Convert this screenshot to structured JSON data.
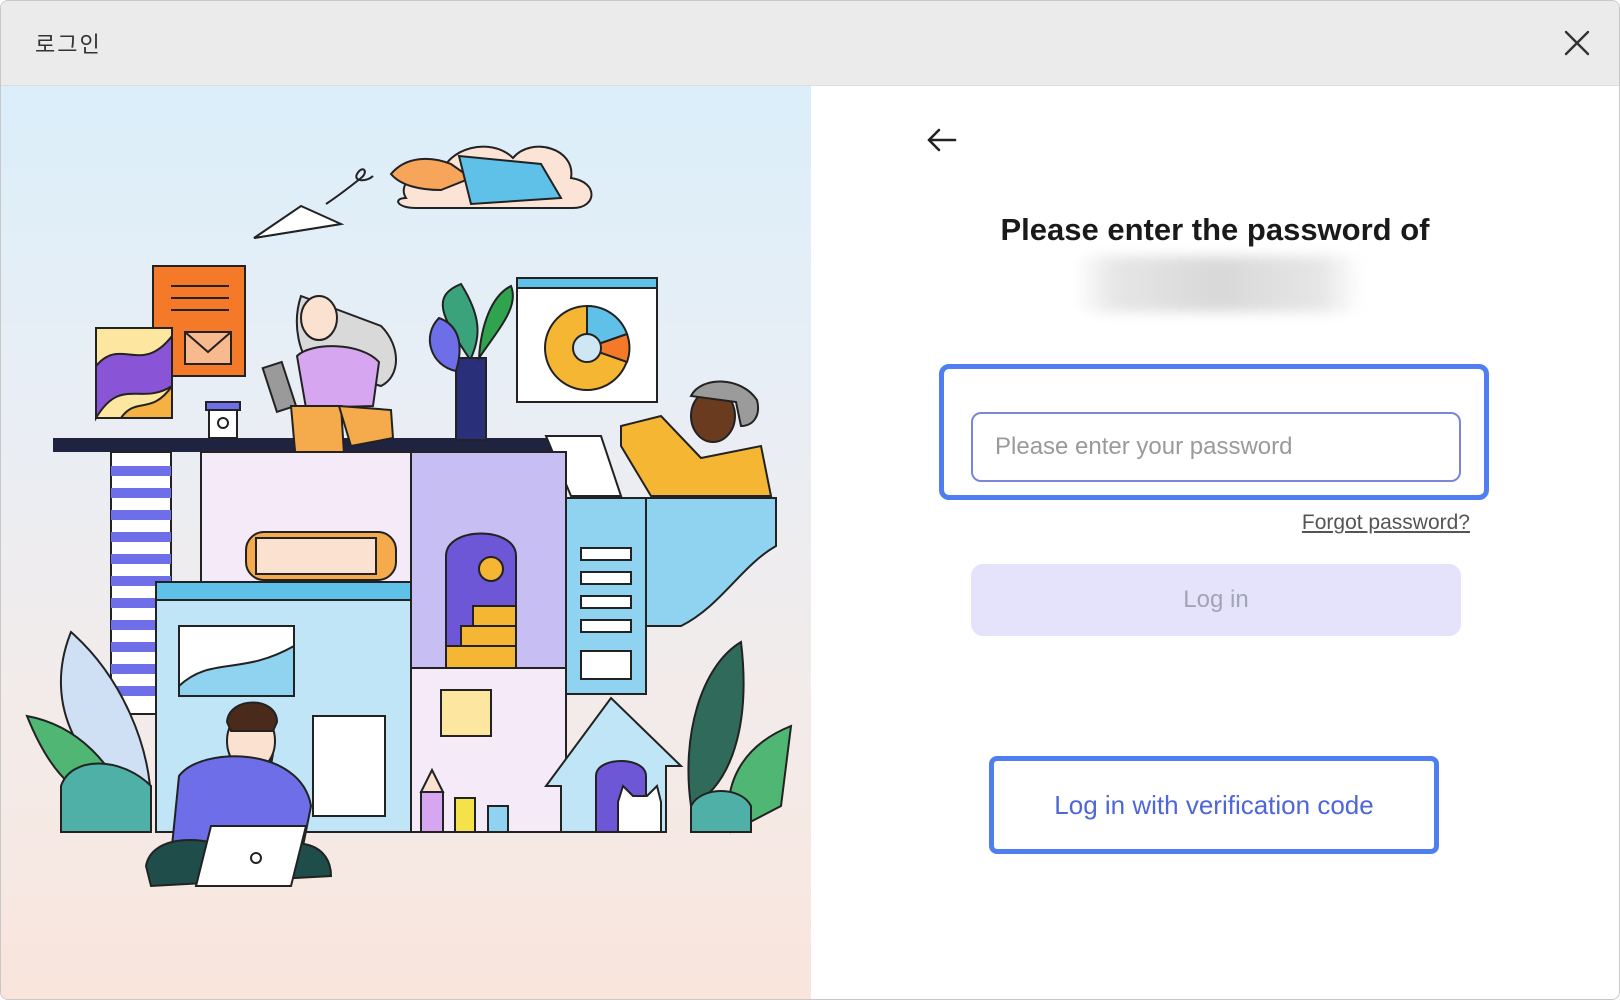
{
  "window": {
    "title": "로그인",
    "close_icon": "close-icon"
  },
  "login": {
    "back_icon": "arrow-left-icon",
    "heading": "Please enter the password of",
    "password_placeholder": "Please enter your password",
    "password_value": "",
    "forgot_password": "Forgot password?",
    "login_button": "Log in",
    "verification_button": "Log in with verification code"
  },
  "colors": {
    "accent": "#4f7ef0",
    "login_button_bg": "#e4e3fb",
    "login_button_text": "#a3a3b8",
    "verification_text": "#4f66d8"
  }
}
